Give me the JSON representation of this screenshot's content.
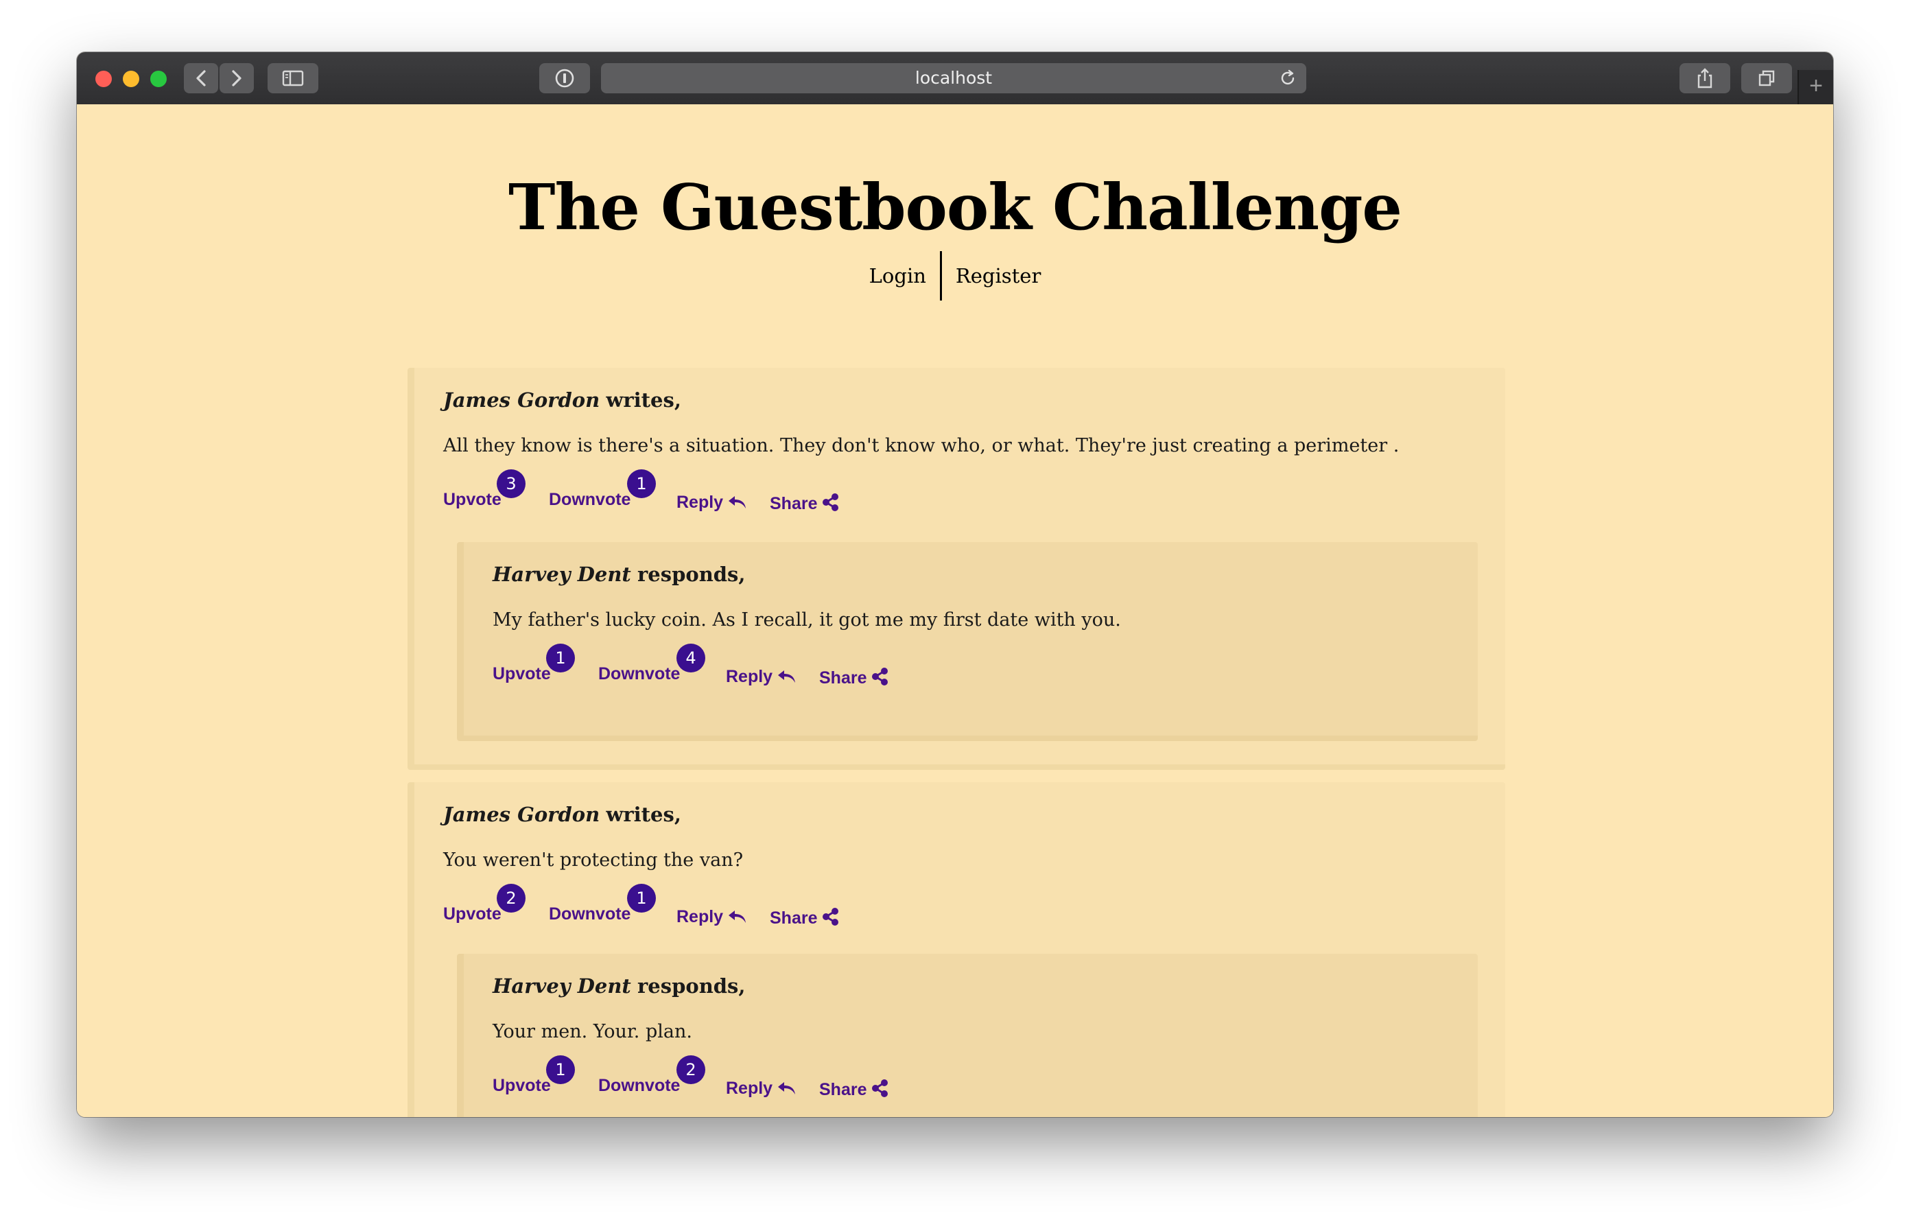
{
  "browser": {
    "url": "localhost"
  },
  "site": {
    "title": "The Guestbook Challenge",
    "nav": {
      "login": "Login",
      "register": "Register"
    }
  },
  "labels": {
    "upvote": "Upvote",
    "downvote": "Downvote",
    "reply": "Reply",
    "share": "Share"
  },
  "accent_color": "#3a0f8f",
  "posts": [
    {
      "author": "James Gordon",
      "verb": "writes,",
      "message": "All they know is there's a situation. They don't know who, or what. They're just creating a perimeter .",
      "upvotes": "3",
      "downvotes": "1",
      "reply": {
        "author": "Harvey Dent",
        "verb": "responds,",
        "message": "My father's lucky coin. As I recall, it got me my first date with you.",
        "upvotes": "1",
        "downvotes": "4"
      }
    },
    {
      "author": "James Gordon",
      "verb": "writes,",
      "message": "You weren't protecting the van?",
      "upvotes": "2",
      "downvotes": "1",
      "reply": {
        "author": "Harvey Dent",
        "verb": "responds,",
        "message": "Your men. Your. plan.",
        "upvotes": "1",
        "downvotes": "2"
      }
    }
  ]
}
